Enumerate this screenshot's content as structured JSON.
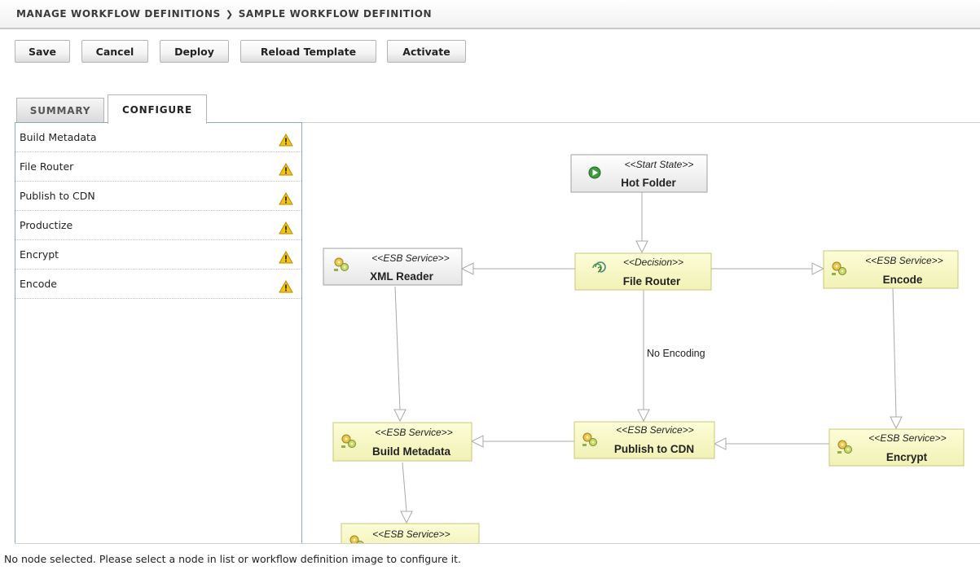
{
  "breadcrumb": {
    "parent": "MANAGE WORKFLOW DEFINITIONS",
    "separator": "❯",
    "current": "SAMPLE WORKFLOW DEFINITION"
  },
  "toolbar": {
    "save": "Save",
    "cancel": "Cancel",
    "deploy": "Deploy",
    "reload_template": "Reload Template",
    "activate": "Activate"
  },
  "tabs": {
    "summary": "SUMMARY",
    "configure": "CONFIGURE",
    "active": "configure"
  },
  "node_list": [
    {
      "label": "Build Metadata",
      "icon": "warning-icon"
    },
    {
      "label": "File Router",
      "icon": "warning-icon"
    },
    {
      "label": "Publish to CDN",
      "icon": "warning-icon"
    },
    {
      "label": "Productize",
      "icon": "warning-icon"
    },
    {
      "label": "Encrypt",
      "icon": "warning-icon"
    },
    {
      "label": "Encode",
      "icon": "warning-icon"
    }
  ],
  "workflow": {
    "nodes": {
      "hot_folder": {
        "stereotype": "<<Start State>>",
        "name": "Hot Folder",
        "icon": "play-icon"
      },
      "xml_reader": {
        "stereotype": "<<ESB Service>>",
        "name": "XML Reader",
        "icon": "esb-service-icon"
      },
      "file_router": {
        "stereotype": "<<Decision>>",
        "name": "File Router",
        "icon": "decision-icon"
      },
      "encode": {
        "stereotype": "<<ESB Service>>",
        "name": "Encode",
        "icon": "esb-service-icon"
      },
      "build_metadata": {
        "stereotype": "<<ESB Service>>",
        "name": "Build Metadata",
        "icon": "esb-service-icon"
      },
      "publish_cdn": {
        "stereotype": "<<ESB Service>>",
        "name": "Publish to CDN",
        "icon": "esb-service-icon"
      },
      "encrypt": {
        "stereotype": "<<ESB Service>>",
        "name": "Encrypt",
        "icon": "esb-service-icon"
      },
      "partial": {
        "stereotype": "<<ESB Service>>",
        "icon": "esb-service-icon"
      }
    },
    "edge_label": "No Encoding"
  },
  "colors": {
    "service_fill": "#fafac8",
    "service_border": "#c8c878",
    "state_fill": "#f4f4f4",
    "state_border": "#a0a0a0",
    "edge": "#a8a8a8",
    "warning": "#f2c418"
  },
  "status_message": "No node selected. Please select a node in list or workflow definition image to configure it."
}
